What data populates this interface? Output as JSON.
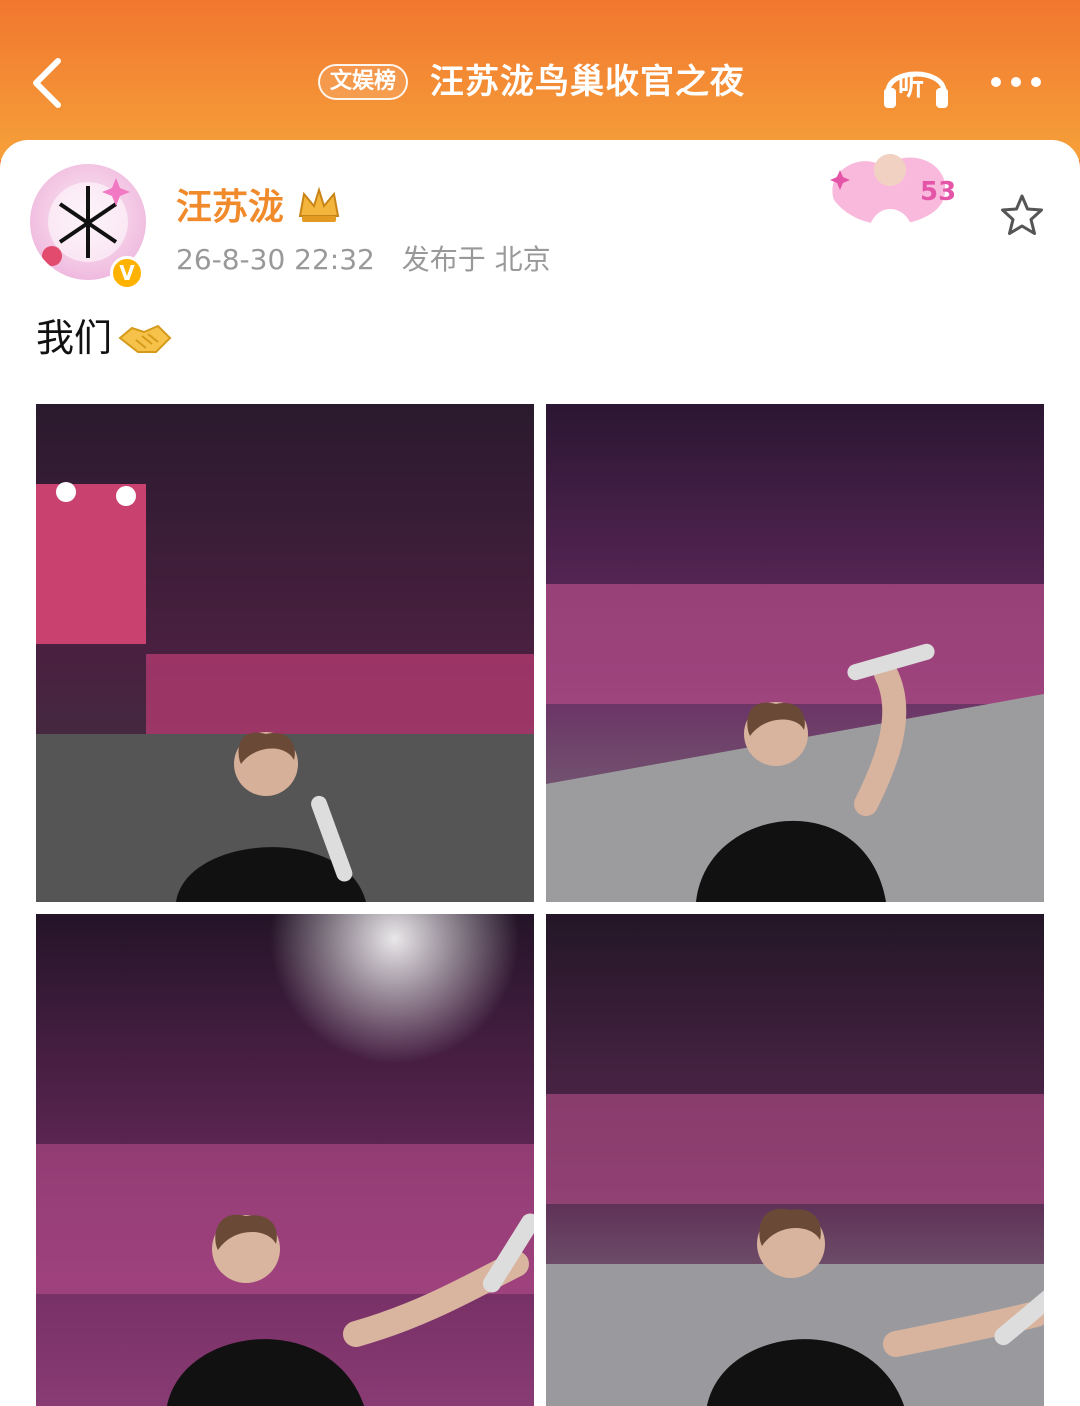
{
  "topbar": {
    "back_icon": "chevron-left-icon",
    "badge": "文娱榜",
    "title": "汪苏泷鸟巢收官之夜",
    "listen_label": "听",
    "more_icon": "more-dots-icon"
  },
  "post": {
    "author": "汪苏泷",
    "time": "26-8-30 22:32",
    "location": "发布于 北京",
    "text": "我们",
    "emoji": "handshake-icon"
  },
  "colors": {
    "header_top": "#f1772f",
    "header_bottom": "#f6a03a",
    "username": "#f08a2a",
    "meta": "#999999"
  },
  "photos": [
    {
      "name": "photo-1",
      "desc_icon": "stadium-selfie-image"
    },
    {
      "name": "photo-2",
      "desc_icon": "stadium-selfie-image"
    },
    {
      "name": "photo-3",
      "desc_icon": "stadium-selfie-image"
    },
    {
      "name": "photo-4",
      "desc_icon": "stadium-selfie-image"
    }
  ]
}
